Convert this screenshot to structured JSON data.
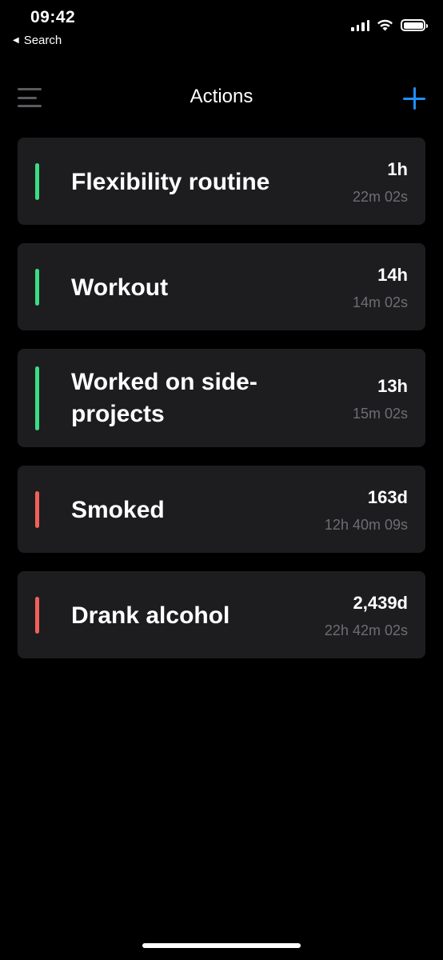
{
  "status_bar": {
    "time": "09:42",
    "back_label": "Search",
    "icons": [
      "cellular-signal-icon",
      "wifi-icon",
      "battery-icon"
    ]
  },
  "nav": {
    "title": "Actions",
    "menu_icon": "hamburger-menu-icon",
    "add_icon": "plus-icon",
    "add_color": "#1e90ff"
  },
  "actions": [
    {
      "title": "Flexibility routine",
      "primary": "1h",
      "secondary": "22m 02s",
      "indicator_color": "#3ddc84"
    },
    {
      "title": "Workout",
      "primary": "14h",
      "secondary": "14m 02s",
      "indicator_color": "#3ddc84"
    },
    {
      "title": "Worked on side-projects",
      "primary": "13h",
      "secondary": "15m 02s",
      "indicator_color": "#3ddc84"
    },
    {
      "title": "Smoked",
      "primary": "163d",
      "secondary": "12h 40m 09s",
      "indicator_color": "#f0605a"
    },
    {
      "title": "Drank alcohol",
      "primary": "2,439d",
      "secondary": "22h 42m 02s",
      "indicator_color": "#f0605a"
    }
  ]
}
